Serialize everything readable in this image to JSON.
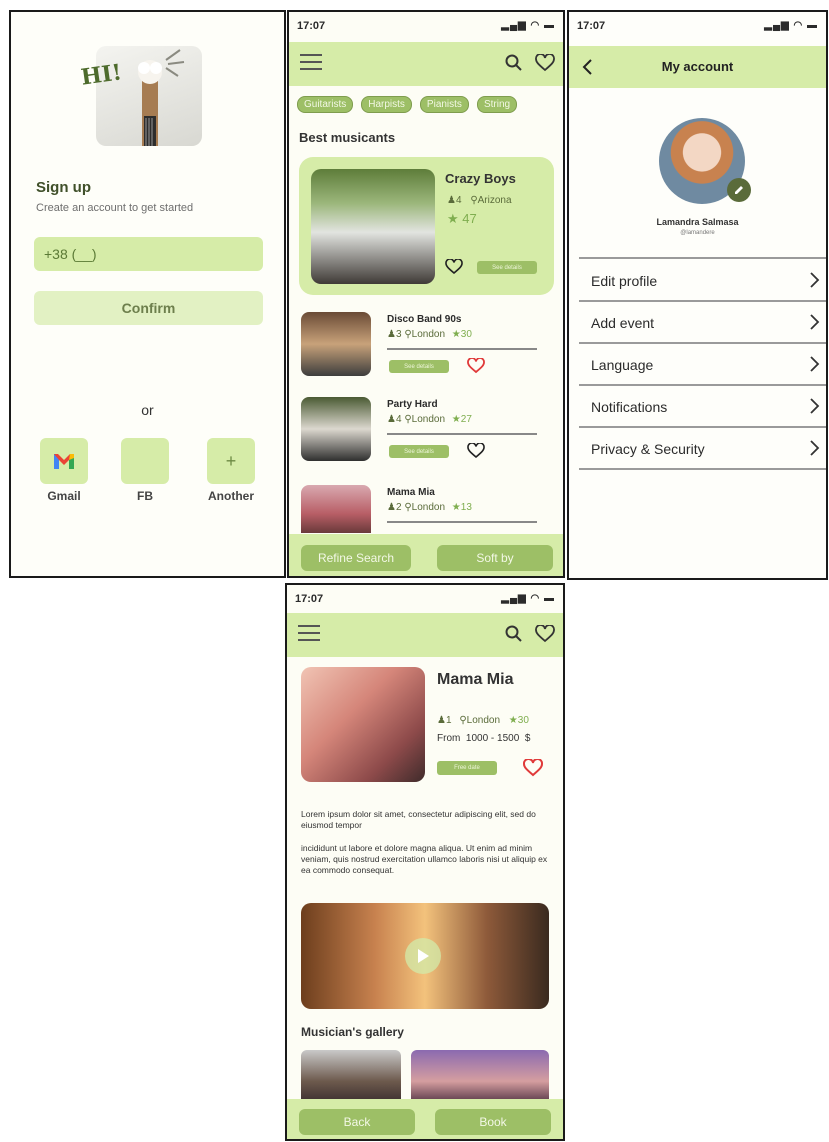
{
  "colors": {
    "accent": "#d6eca8",
    "button": "#9dbf66",
    "heart_red": "#e03a3a",
    "dark_green": "#5a6b3a"
  },
  "signup": {
    "hi": "HI!",
    "title": "Sign up",
    "subtitle": "Create an account to get started",
    "phone_value": "+38 (__)",
    "confirm": "Confirm",
    "or": "or",
    "socials": [
      {
        "label": "Gmail",
        "icon": "gmail-icon"
      },
      {
        "label": "FB",
        "icon": "facebook-icon"
      },
      {
        "label": "Another",
        "icon": "plus-icon",
        "glyph": "+"
      }
    ]
  },
  "list": {
    "time": "17:07",
    "filters": [
      "Guitarists",
      "Harpists",
      "Pianists",
      "String"
    ],
    "section": "Best musicants",
    "featured": {
      "name": "Crazy Boys",
      "members": "4",
      "city": "Arizona",
      "rating": "47",
      "details": "See details"
    },
    "items": [
      {
        "name": "Disco Band 90s",
        "members": "3",
        "city": "London",
        "rating": "30",
        "details": "See details",
        "liked": true
      },
      {
        "name": "Party Hard",
        "members": "4",
        "city": "London",
        "rating": "27",
        "details": "See details",
        "liked": false
      },
      {
        "name": "Mama Mia",
        "members": "2",
        "city": "London",
        "rating": "13"
      }
    ],
    "refine": "Refine Search",
    "sort": "Soft by"
  },
  "account": {
    "time": "17:07",
    "title": "My account",
    "name": "Lamandra Salmasa",
    "handle": "@lamandere",
    "menu": [
      "Edit profile",
      "Add event",
      "Language",
      "Notifications",
      "Privacy & Security"
    ]
  },
  "detail": {
    "time": "17:07",
    "name": "Mama Mia",
    "members": "1",
    "city": "London",
    "rating": "30",
    "price": "From  1000 - 1500  $",
    "free_date": "Free date",
    "para1": "Lorem ipsum dolor sit amet, consectetur adipiscing elit, sed do eiusmod tempor",
    "para2": "incididunt ut labore et dolore magna aliqua. Ut enim ad minim veniam, quis nostrud exercitation ullamco laboris nisi ut aliquip ex ea commodo consequat.",
    "gallery": "Musician's gallery",
    "back": "Back",
    "book": "Book"
  }
}
